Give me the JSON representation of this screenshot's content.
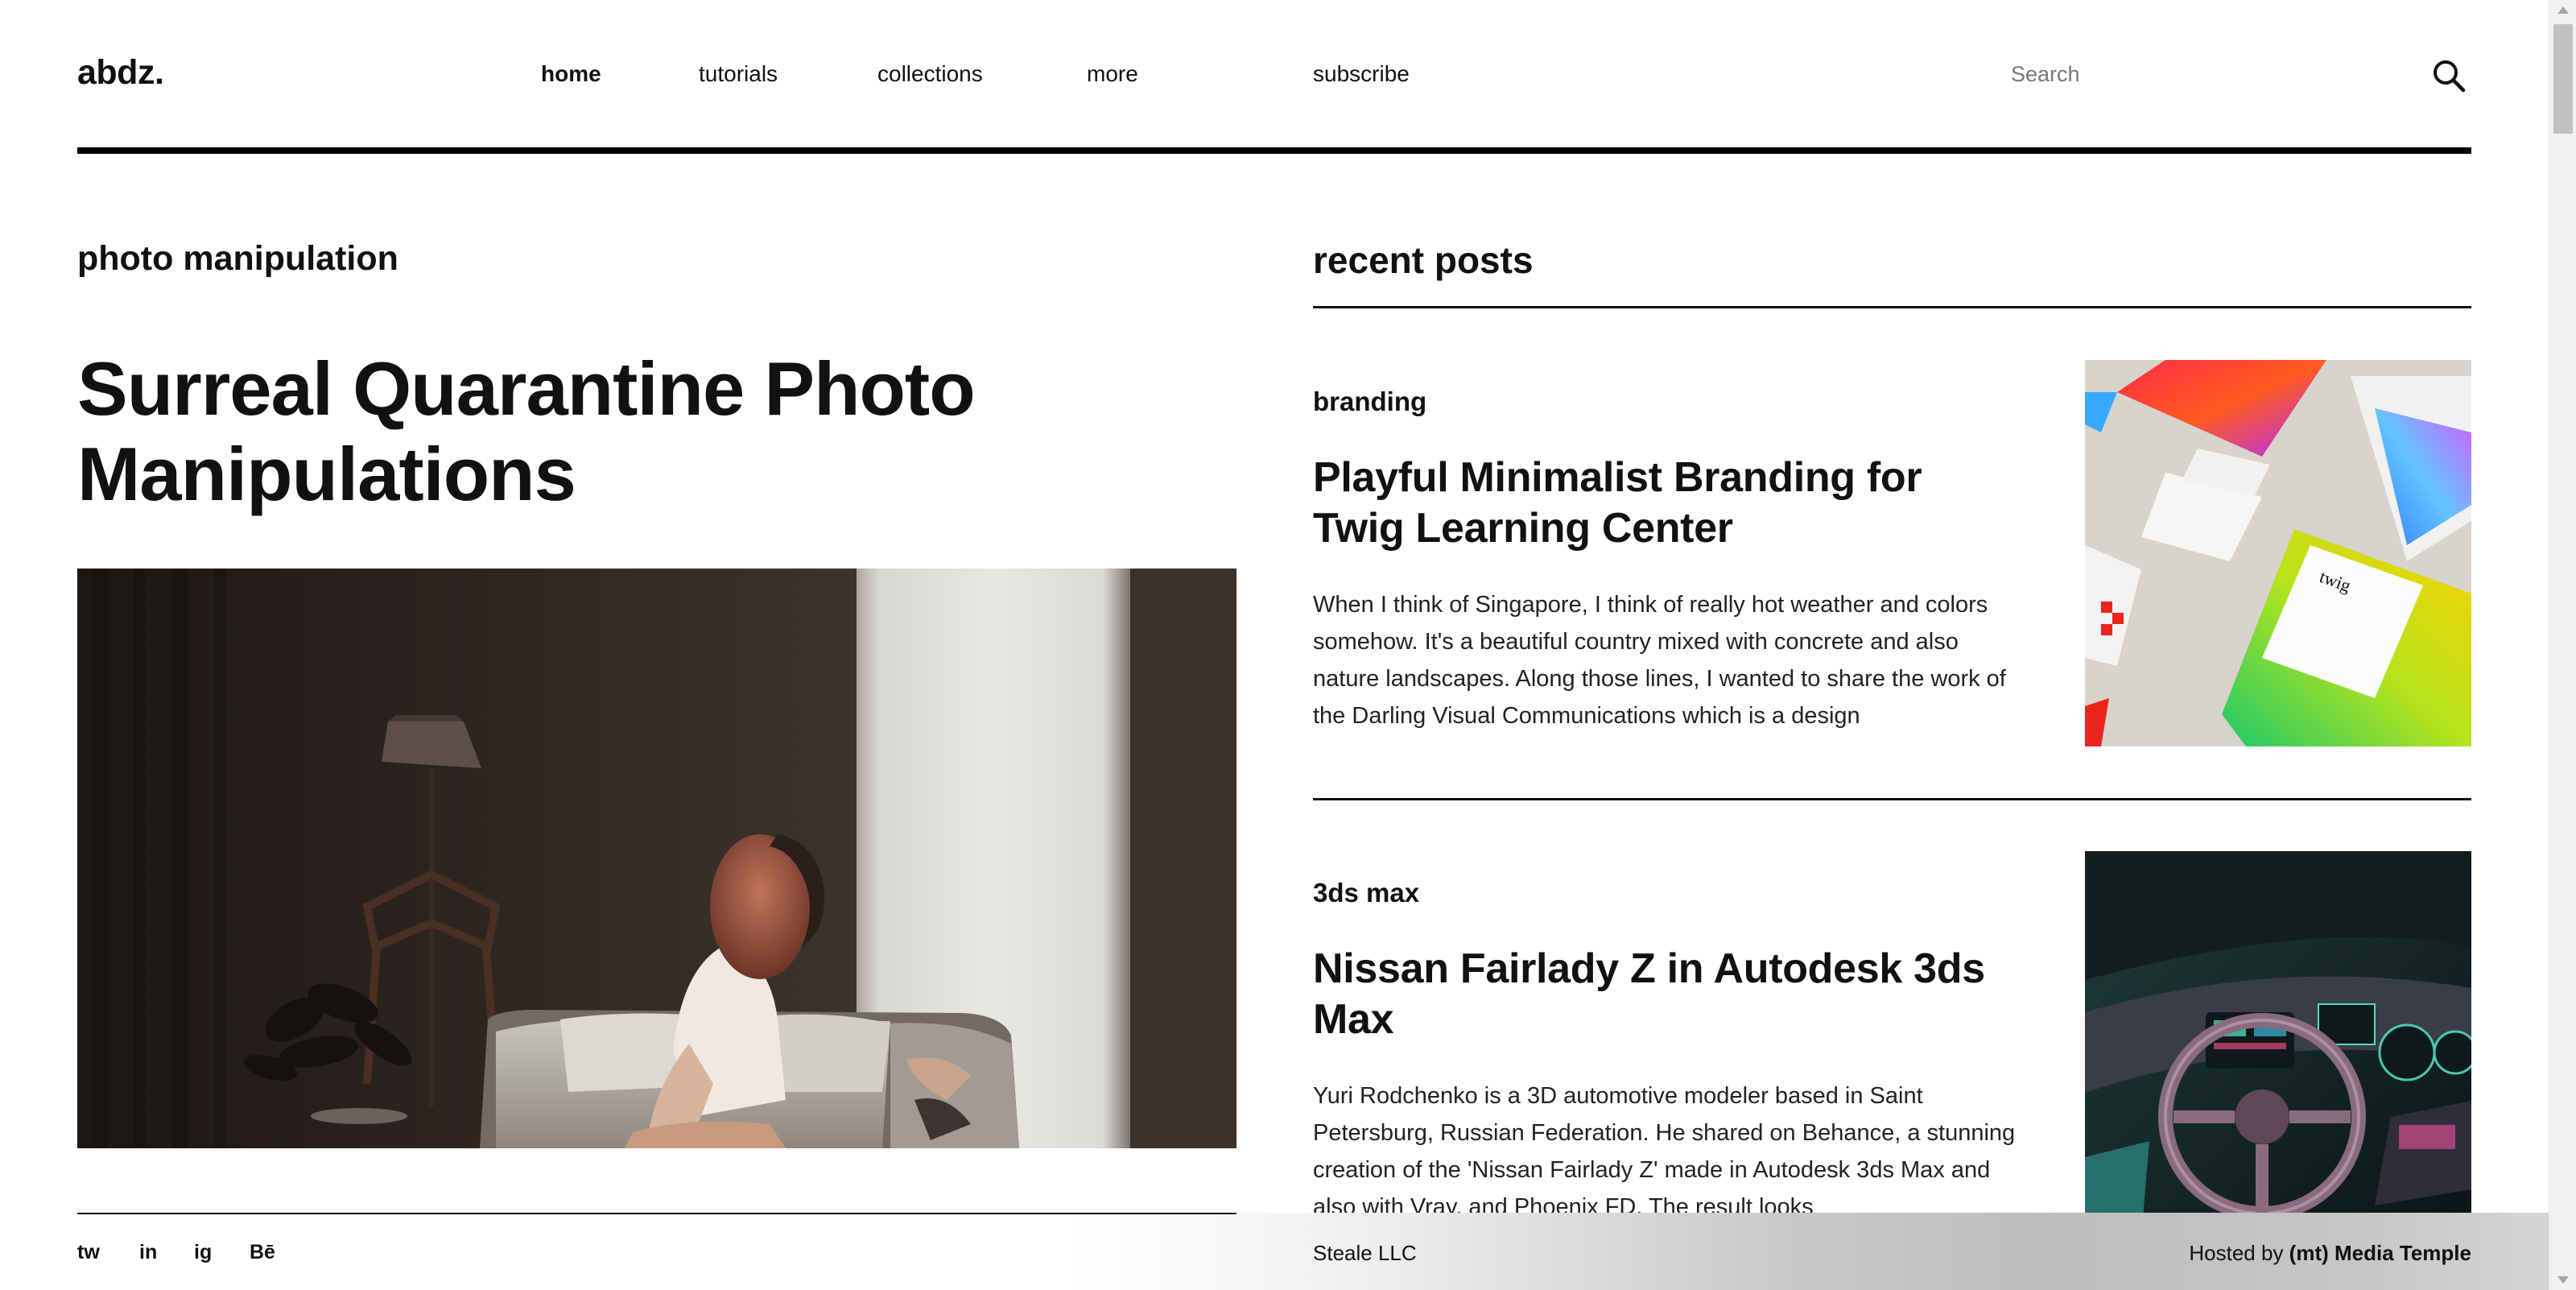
{
  "header": {
    "logo": "abdz.",
    "nav": [
      {
        "label": "home",
        "active": true
      },
      {
        "label": "tutorials"
      },
      {
        "label": "collections"
      },
      {
        "label": "more"
      },
      {
        "label": "subscribe"
      }
    ],
    "search_placeholder": "Search",
    "search_icon": "search-icon"
  },
  "featured": {
    "category": "photo manipulation",
    "title": "Surreal Quarantine Photo Manipulations"
  },
  "sidebar": {
    "title": "recent posts",
    "posts": [
      {
        "tag": "branding",
        "title": "Playful Minimalist Branding for Twig Learning Center",
        "excerpt": "When I think of Singapore, I think of really hot weather and colors somehow. It's a beautiful country mixed with concrete and also nature landscapes. Along those lines, I wanted to share the work of the Darling Visual Communications which is a design",
        "thumb_text": "twig"
      },
      {
        "tag": "3ds max",
        "title": "Nissan Fairlady Z in Autodesk 3ds Max",
        "excerpt": "Yuri Rodchenko is a 3D automotive modeler based in Saint Petersburg, Russian Federation. He shared on Behance, a stunning creation of the 'Nissan Fairlady Z' made in Autodesk 3ds Max and also with Vray, and Phoenix FD. The result looks"
      }
    ]
  },
  "footer": {
    "social": [
      "tw",
      "in",
      "ig",
      "Bē"
    ],
    "copyright": "Steale LLC",
    "hosted_prefix": "Hosted by ",
    "hosted_brand": "(mt) Media Temple"
  }
}
